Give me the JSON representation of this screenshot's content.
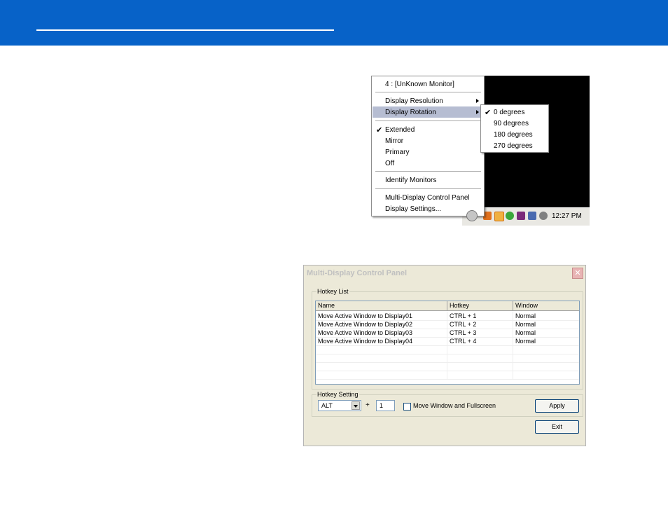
{
  "tray_menu": {
    "monitor_title": "4 : [UnKnown Monitor]",
    "items": [
      {
        "label": "Display Resolution",
        "has_submenu": true
      },
      {
        "label": "Display Rotation",
        "has_submenu": true,
        "selected": true
      },
      {
        "label": "Extended",
        "checked": true
      },
      {
        "label": "Mirror"
      },
      {
        "label": "Primary"
      },
      {
        "label": "Off"
      },
      {
        "label": "Identify Monitors"
      },
      {
        "label": "Multi-Display Control Panel"
      },
      {
        "label": "Display Settings..."
      }
    ],
    "rotation_submenu": [
      {
        "label": "0 degrees",
        "checked": true
      },
      {
        "label": "90 degrees"
      },
      {
        "label": "180 degrees"
      },
      {
        "label": "270 degrees"
      }
    ],
    "clock": "12:27 PM",
    "check_glyph": "✔"
  },
  "dialog": {
    "title": "Multi-Display Control Panel",
    "close_glyph": "✕",
    "hotkey_list_label": "Hotkey List",
    "columns": [
      "Name",
      "Hotkey",
      "Window"
    ],
    "rows": [
      [
        "Move Active Window to Display01",
        "CTRL + 1",
        "Normal"
      ],
      [
        "Move Active Window to Display02",
        "CTRL + 2",
        "Normal"
      ],
      [
        "Move Active Window to Display03",
        "CTRL + 3",
        "Normal"
      ],
      [
        "Move Active Window to Display04",
        "CTRL + 4",
        "Normal"
      ]
    ],
    "hotkey_setting_label": "Hotkey Setting",
    "modifier_value": "ALT",
    "plus": "+",
    "key_value": "1",
    "fullscreen_label": "Move Window and Fullscreen",
    "apply_label": "Apply",
    "exit_label": "Exit"
  },
  "colors": {
    "header_blue": "#0762c8",
    "menu_highlight": "#b6bdd2",
    "dialog_bg": "#ece9d8"
  }
}
